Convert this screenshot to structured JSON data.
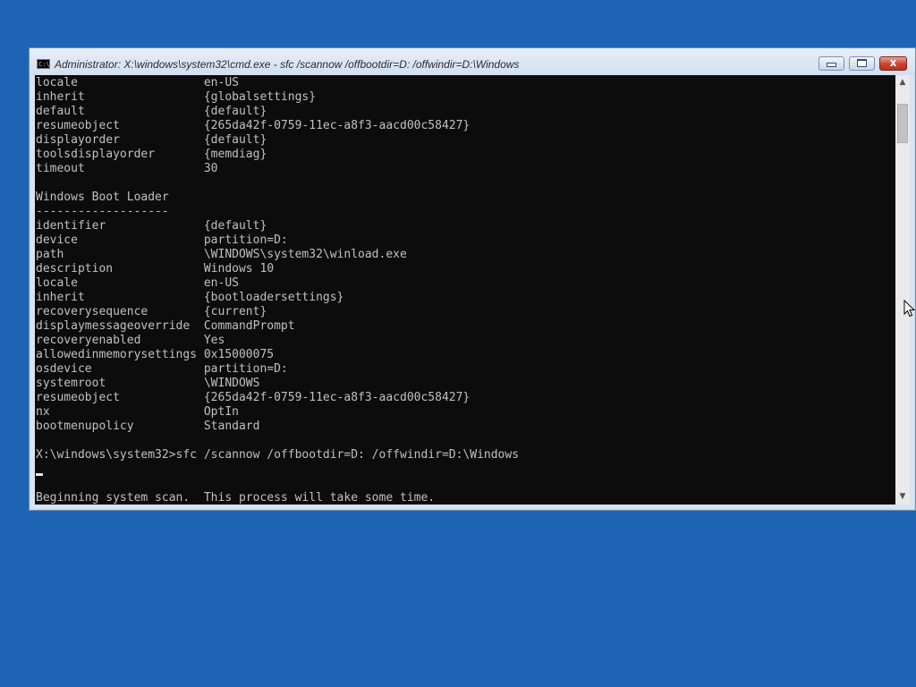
{
  "window": {
    "title": "Administrator: X:\\windows\\system32\\cmd.exe - sfc  /scannow /offbootdir=D: /offwindir=D:\\Windows",
    "icon": "cmd-icon",
    "icon_glyph": "C:\\"
  },
  "controls": {
    "minimize": "minimize-icon",
    "maximize": "maximize-icon",
    "close": "close-icon",
    "close_glyph": "x"
  },
  "scrollbar": {
    "up_glyph": "▲",
    "down_glyph": "▼"
  },
  "console": {
    "lines": [
      "locale                  en-US",
      "inherit                 {globalsettings}",
      "default                 {default}",
      "resumeobject            {265da42f-0759-11ec-a8f3-aacd00c58427}",
      "displayorder            {default}",
      "toolsdisplayorder       {memdiag}",
      "timeout                 30",
      "",
      "Windows Boot Loader",
      "-------------------",
      "identifier              {default}",
      "device                  partition=D:",
      "path                    \\WINDOWS\\system32\\winload.exe",
      "description             Windows 10",
      "locale                  en-US",
      "inherit                 {bootloadersettings}",
      "recoverysequence        {current}",
      "displaymessageoverride  CommandPrompt",
      "recoveryenabled         Yes",
      "allowedinmemorysettings 0x15000075",
      "osdevice                partition=D:",
      "systemroot              \\WINDOWS",
      "resumeobject            {265da42f-0759-11ec-a8f3-aacd00c58427}",
      "nx                      OptIn",
      "bootmenupolicy          Standard",
      "",
      "X:\\windows\\system32>sfc /scannow /offbootdir=D: /offwindir=D:\\Windows",
      "",
      "",
      "Beginning system scan.  This process will take some time."
    ]
  }
}
